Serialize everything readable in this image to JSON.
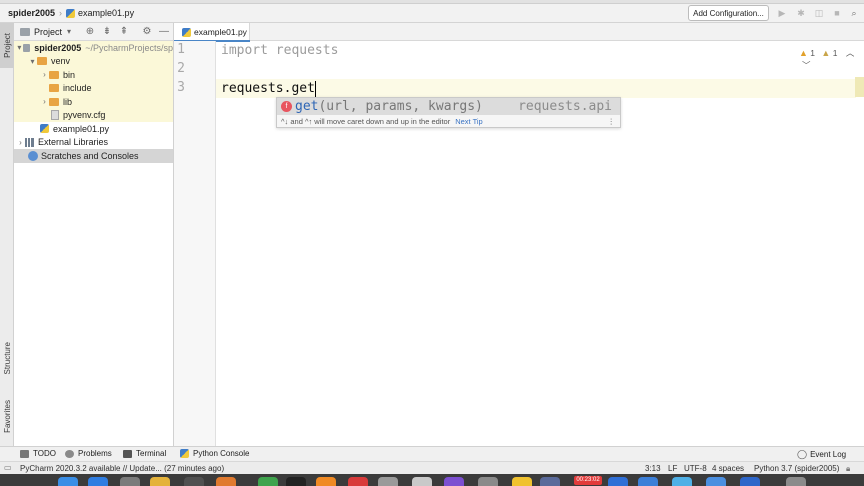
{
  "navbar": {
    "project": "spider2005",
    "separator": "›",
    "file": "example01.py",
    "run_config": "Add Configuration..."
  },
  "left_strip": {
    "project_tab": "Project",
    "structure_tab": "Structure",
    "favorites_tab": "Favorites"
  },
  "project_panel": {
    "title": "Project",
    "tree": [
      {
        "label": "spider2005",
        "extra": "~/PycharmProjects/sp",
        "kind": "root"
      },
      {
        "label": "venv",
        "kind": "folder"
      },
      {
        "label": "bin",
        "kind": "folder"
      },
      {
        "label": "include",
        "kind": "folder"
      },
      {
        "label": "lib",
        "kind": "folder"
      },
      {
        "label": "pyvenv.cfg",
        "kind": "file"
      },
      {
        "label": "example01.py",
        "kind": "python"
      },
      {
        "label": "External Libraries",
        "kind": "library"
      },
      {
        "label": "Scratches and Consoles",
        "kind": "scratch"
      }
    ]
  },
  "editor": {
    "tab": "example01.py",
    "line_numbers": [
      "1",
      "2",
      "3"
    ],
    "lines": [
      "import requests",
      "",
      "requests.get"
    ],
    "warnings": "1",
    "weak_warnings": "1"
  },
  "completion": {
    "icon": "f",
    "name": "get",
    "signature": "(url, params, kwargs)",
    "module": "requests.api",
    "hint": "^↓ and ^↑ will move caret down and up in the editor",
    "tip_link": "Next Tip",
    "more": "⋮"
  },
  "bottom_tabs": {
    "todo": "TODO",
    "problems": "Problems",
    "terminal": "Terminal",
    "python_console": "Python Console",
    "event_log": "Event Log"
  },
  "status_bar": {
    "message": "PyCharm 2020.3.2 available // Update... (27 minutes ago)",
    "position": "3:13",
    "line_separator": "LF",
    "encoding": "UTF-8",
    "indent": "4 spaces",
    "interpreter": "Python 3.7 (spider2005)"
  },
  "dock": {
    "clock": "00:23:02"
  }
}
